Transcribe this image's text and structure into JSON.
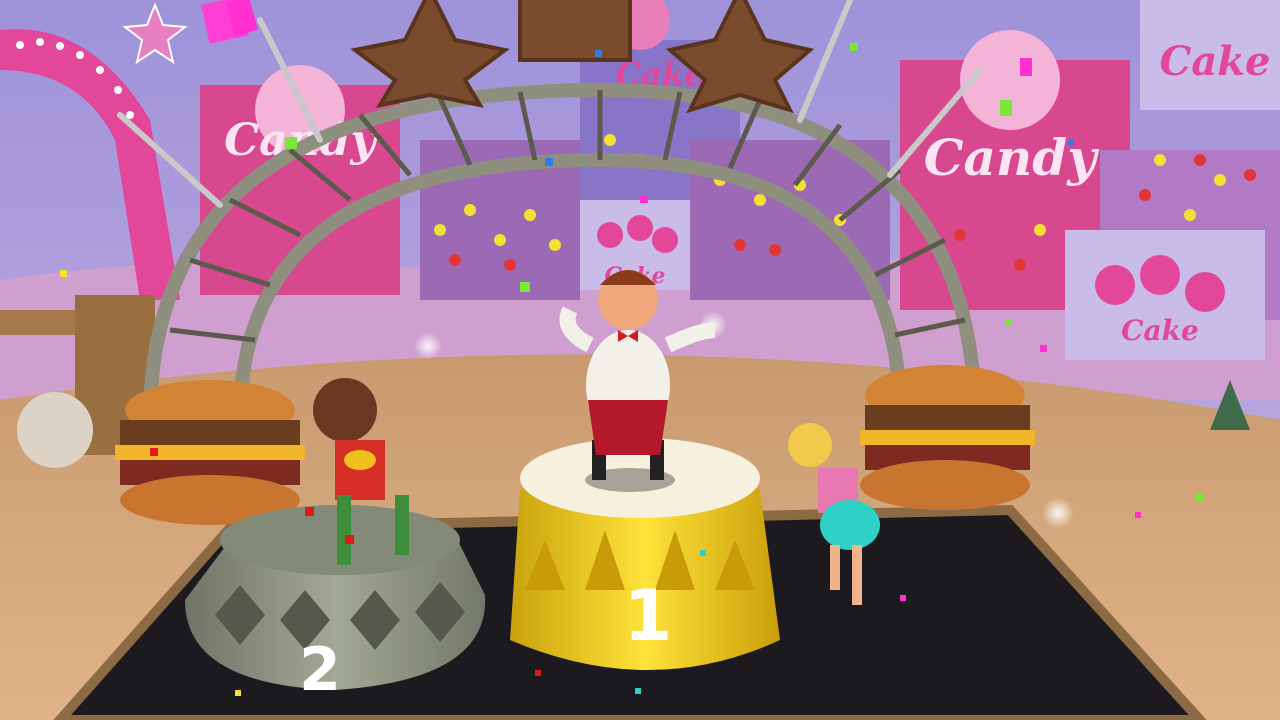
{
  "scene": {
    "description_free": true,
    "colors": {
      "sky": "#a99bd8",
      "banner_pink": "#d8488f",
      "stage_black": "#1c1a1f",
      "podium_gold": "#f4d21c",
      "podium_silver": "#8d9281",
      "wood_floor": "#d2a578"
    }
  },
  "signs": {
    "candy_left": "Candy",
    "candy_right": "Candy",
    "cake_top": "Cake",
    "cake_right": "Cake",
    "cake_center": "Cake",
    "cake_far_right": "Cake"
  },
  "podiums": {
    "first_number": "1",
    "second_number": "2"
  },
  "characters": {
    "first": "chef-character",
    "second": "girl-character-brown-hair",
    "third": "girl-character-blonde"
  },
  "icons": [
    "star-icon",
    "burger-icon",
    "fork-icon",
    "lollipop-icon"
  ]
}
